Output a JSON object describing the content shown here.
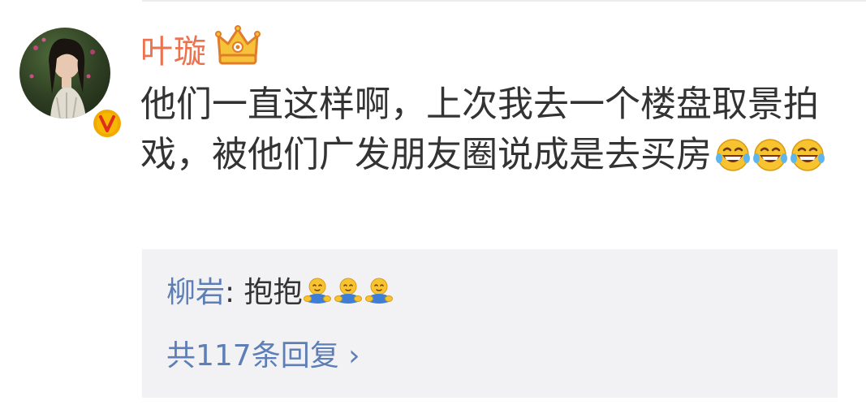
{
  "comment": {
    "author": "叶璇",
    "text": "他们一直这样啊，上次我去一个楼盘取景拍戏，被他们广发朋友圈说成是去买房",
    "emojis": [
      "laugh-cry-emoji",
      "laugh-cry-emoji",
      "laugh-cry-emoji"
    ],
    "badge_icon": "crown-icon",
    "verified_icon": "verified-v-icon"
  },
  "reply": {
    "author": "柳岩",
    "separator": ": ",
    "text": "抱抱",
    "emojis": [
      "hug-emoji",
      "hug-emoji",
      "hug-emoji"
    ]
  },
  "more_replies": {
    "label": "共117条回复 ›"
  },
  "colors": {
    "username": "#eb7350",
    "link": "#5d7fb5",
    "text": "#333333",
    "reply_bg": "#f2f2f5",
    "verified": "#f2a900"
  }
}
